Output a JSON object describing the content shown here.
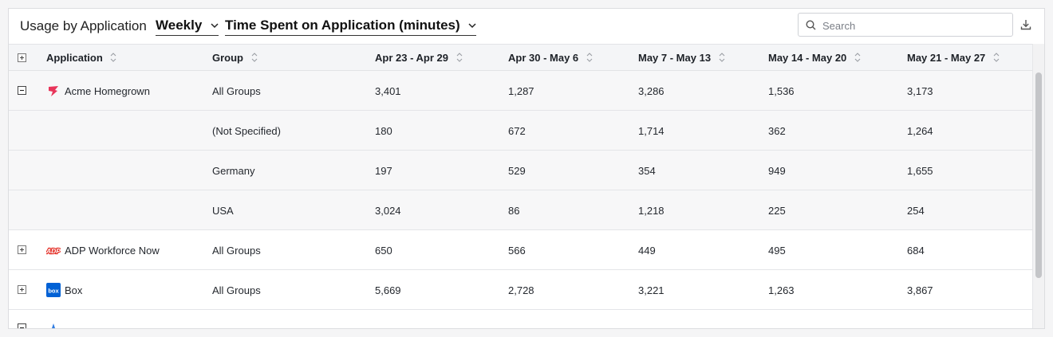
{
  "toolbar": {
    "title": "Usage by Application",
    "period": "Weekly",
    "metric": "Time Spent on Application (minutes)",
    "search_placeholder": "Search"
  },
  "columns": {
    "application": "Application",
    "group": "Group",
    "weeks": [
      "Apr 23 - Apr 29",
      "Apr 30 - May 6",
      "May 7 - May 13",
      "May 14 - May 20",
      "May 21 - May 27"
    ]
  },
  "rows": [
    {
      "app": "Acme Homegrown",
      "group": "All Groups",
      "values": [
        "3,401",
        "1,287",
        "3,286",
        "1,536",
        "3,173"
      ],
      "icon": "acme-icon",
      "expanded": true
    },
    {
      "app": "",
      "group": "(Not Specified)",
      "values": [
        "180",
        "672",
        "1,714",
        "362",
        "1,264"
      ]
    },
    {
      "app": "",
      "group": "Germany",
      "values": [
        "197",
        "529",
        "354",
        "949",
        "1,655"
      ]
    },
    {
      "app": "",
      "group": "USA",
      "values": [
        "3,024",
        "86",
        "1,218",
        "225",
        "254"
      ]
    },
    {
      "app": "ADP Workforce Now",
      "group": "All Groups",
      "values": [
        "650",
        "566",
        "449",
        "495",
        "684"
      ],
      "icon": "adp-icon",
      "logo_text": "ADP"
    },
    {
      "app": "Box",
      "group": "All Groups",
      "values": [
        "5,669",
        "2,728",
        "3,221",
        "1,263",
        "3,867"
      ],
      "icon": "box-icon",
      "logo_text": "box"
    }
  ],
  "colors": {
    "acme": "#e8355a",
    "adp": "#e2231a",
    "box": "#0061d5",
    "partial": "#2f7de1"
  }
}
